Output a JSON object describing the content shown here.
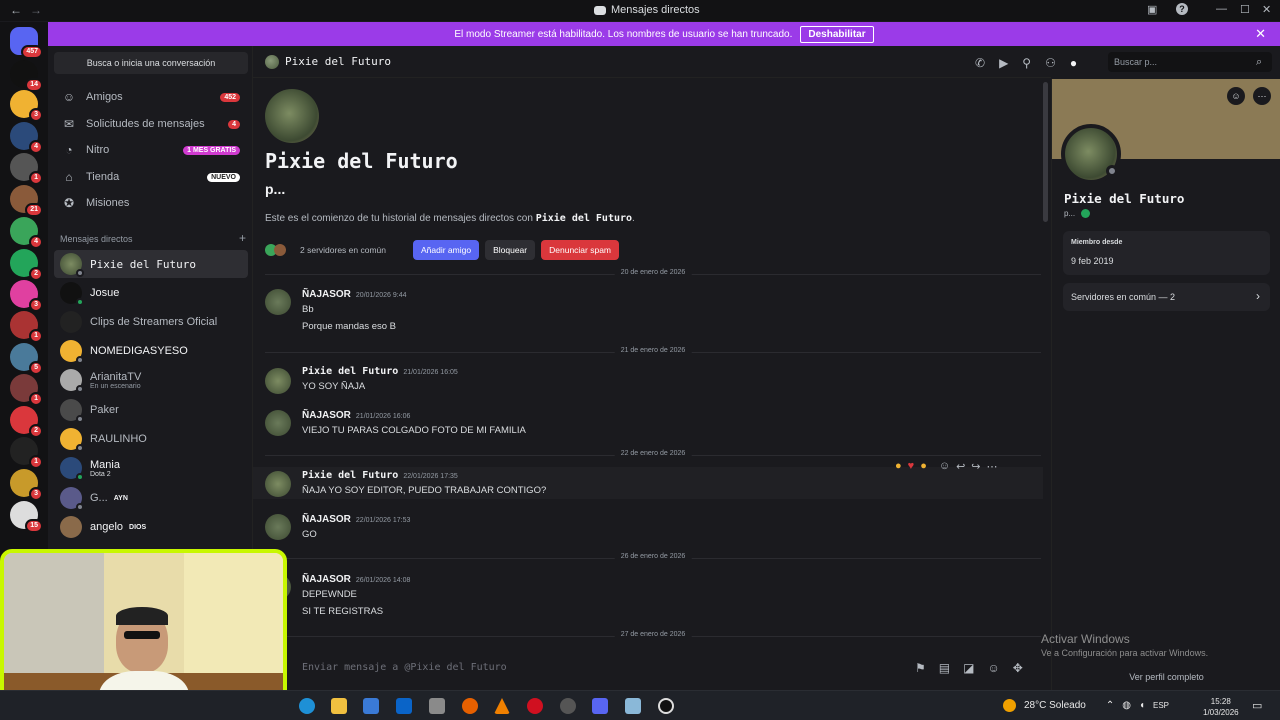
{
  "window": {
    "title": "Mensajes directos"
  },
  "banner": {
    "text": "El modo Streamer está habilitado. Los nombres de usuario se han truncado.",
    "button": "Deshabilitar"
  },
  "servers": [
    {
      "badge": "457",
      "color": "#5865f2"
    },
    {
      "badge": "14",
      "color": "#111111"
    },
    {
      "badge": "3",
      "color": "#f0b232"
    },
    {
      "badge": "4",
      "color": "#2b4a7a"
    },
    {
      "badge": "1",
      "color": "#555555"
    },
    {
      "badge": "21",
      "color": "#8a5a3a"
    },
    {
      "badge": "4",
      "color": "#3aa55a"
    },
    {
      "badge": "2",
      "color": "#23a55a"
    },
    {
      "badge": "3",
      "color": "#e040a0"
    },
    {
      "badge": "1",
      "color": "#aa3333"
    },
    {
      "badge": "5",
      "color": "#4a7a9a"
    },
    {
      "badge": "1",
      "color": "#7a3a3a"
    },
    {
      "badge": "2",
      "color": "#da373c"
    },
    {
      "badge": "1",
      "color": "#222222"
    },
    {
      "badge": "3",
      "color": "#c89a2a"
    },
    {
      "badge": "15",
      "color": "#dddddd"
    }
  ],
  "sidebar": {
    "search": "Busca o inicia una conversación",
    "nav": [
      {
        "label": "Amigos",
        "pill": "452"
      },
      {
        "label": "Solicitudes de mensajes",
        "pill": "4"
      },
      {
        "label": "Nitro",
        "pill": "1 MES GRATIS"
      },
      {
        "label": "Tienda",
        "pill": "NUEVO"
      },
      {
        "label": "Misiones",
        "pill": ""
      }
    ],
    "dm_header": "Mensajes directos",
    "dm_add": "+",
    "dms": [
      {
        "name": "Pixie del Futuro",
        "sub": ""
      },
      {
        "name": "Josue",
        "sub": ""
      },
      {
        "name": "Clips de Streamers Oficial",
        "sub": ""
      },
      {
        "name": "NOMEDIGASYESO",
        "sub": ""
      },
      {
        "name": "ArianitaTV",
        "sub": "En un escenario"
      },
      {
        "name": "Paker",
        "sub": ""
      },
      {
        "name": "RAULINHO",
        "sub": ""
      },
      {
        "name": "Mania",
        "sub": "Dota 2"
      },
      {
        "name": "G...",
        "sub": "",
        "tag": "AYN"
      },
      {
        "name": "angelo",
        "sub": "",
        "tag": "DIOS"
      }
    ]
  },
  "chat": {
    "header_name": "Pixie del Futuro",
    "search_placeholder": "Buscar p...",
    "intro_name": "Pixie del Futuro",
    "intro_sub": "p...",
    "intro_text": "Este es el comienzo de tu historial de mensajes directos con",
    "intro_name_inline": "Pixie del Futuro",
    "intro_period": ".",
    "mutual_servers": "2 servidores en común",
    "btn_add": "Añadir amigo",
    "btn_block": "Bloquear",
    "btn_spam": "Denunciar spam",
    "dividers": [
      "20 de enero de 2026",
      "21 de enero de 2026",
      "22 de enero de 2026",
      "26 de enero de 2026",
      "27 de enero de 2026"
    ],
    "messages": [
      {
        "author": "ÑAJASOR",
        "time": "20/01/2026 9:44",
        "lines": [
          "Bb",
          "Porque mandas eso B"
        ]
      },
      {
        "author": "Pixie del Futuro",
        "time": "21/01/2026 16:05",
        "lines": [
          "YO SOY ÑAJA"
        ]
      },
      {
        "author": "ÑAJASOR",
        "time": "21/01/2026 16:06",
        "lines": [
          "VIEJO TU PARAS COLGADO FOTO DE MI FAMILIA"
        ]
      },
      {
        "author": "Pixie del Futuro",
        "time": "22/01/2026 17:35",
        "lines": [
          "ÑAJA YO SOY EDITOR, PUEDO TRABAJAR CONTIGO?"
        ]
      },
      {
        "author": "ÑAJASOR",
        "time": "22/01/2026 17:53",
        "lines": [
          "GO"
        ]
      },
      {
        "author": "ÑAJASOR",
        "time": "26/01/2026 14:08",
        "lines": [
          "DEPEWNDE",
          "SI TE REGISTRAS"
        ]
      }
    ],
    "composer_placeholder": "Enviar mensaje a @Pixie del Futuro"
  },
  "profile": {
    "name": "Pixie del Futuro",
    "status": "p...",
    "member_since_label": "Miembro desde",
    "member_since": "9 feb 2019",
    "mutual_servers": "Servidores en común — 2",
    "full_profile": "Ver perfil completo"
  },
  "watermark": {
    "title": "Activar Windows",
    "sub": "Ve a Configuración para activar Windows."
  },
  "taskbar": {
    "weather": "28°C Soleado",
    "lang": "ESP",
    "time": "15:28",
    "date": "1/03/2026"
  }
}
